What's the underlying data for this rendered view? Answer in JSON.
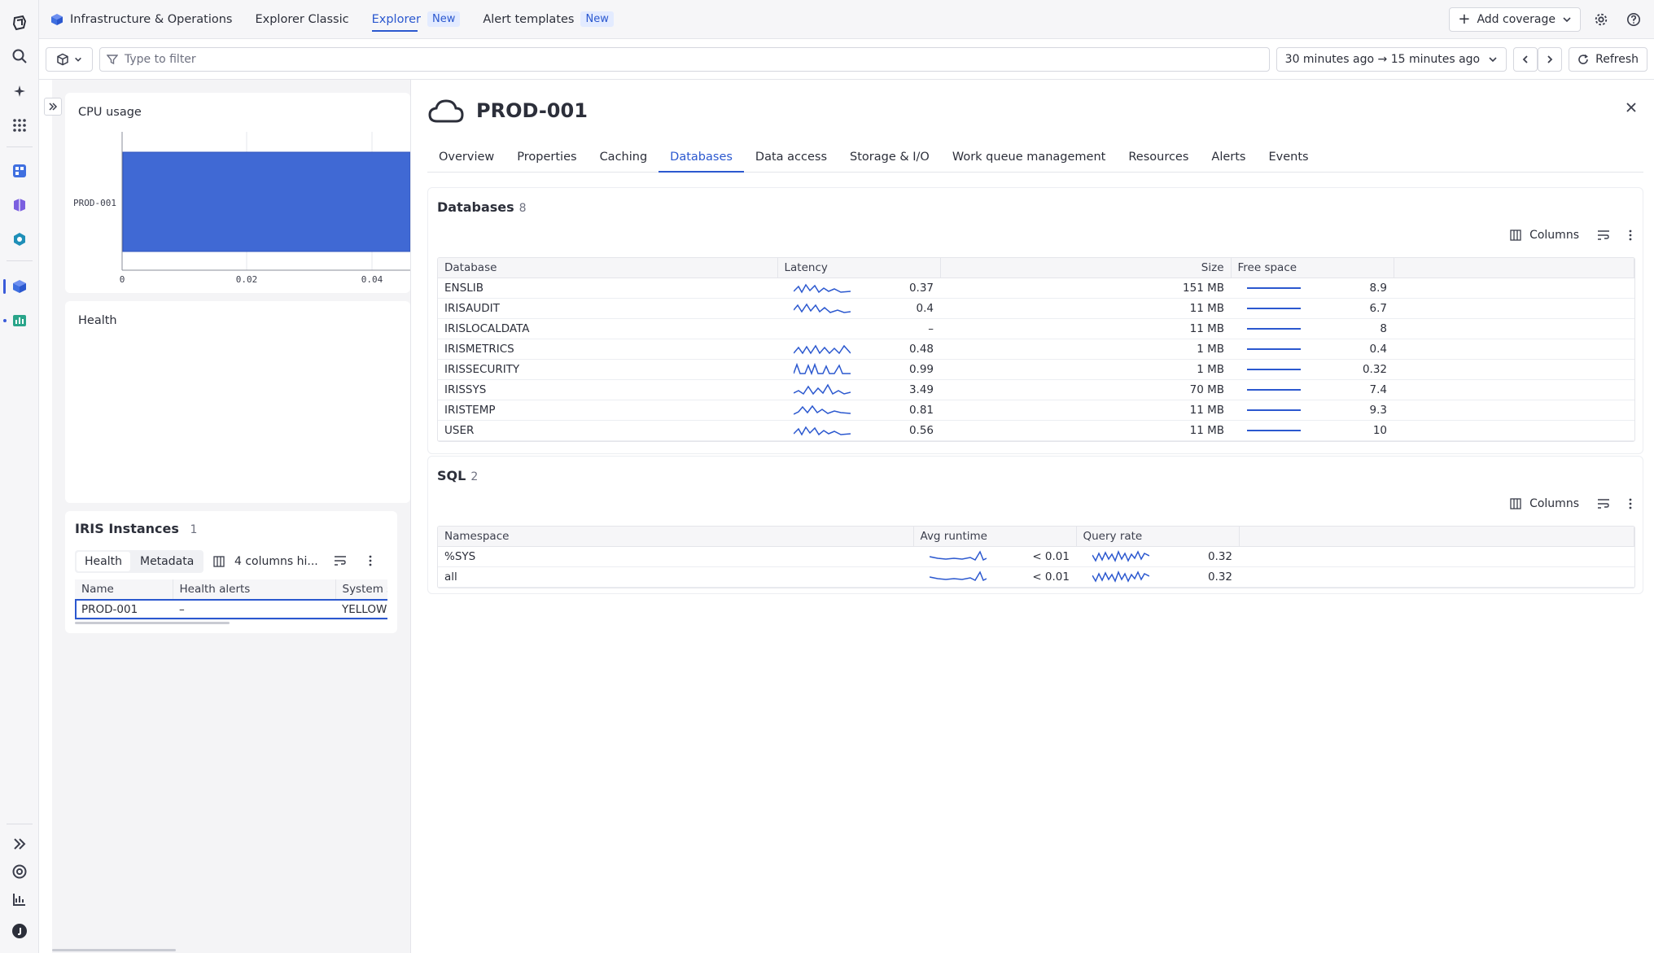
{
  "colors": {
    "accent": "#2b58cf",
    "bar_fill": "#4069d4",
    "bar_border": "#2f53bd"
  },
  "topbar": {
    "apps": [
      {
        "label": "Infrastructure & Operations",
        "badge": ""
      },
      {
        "label": "Explorer Classic",
        "badge": ""
      },
      {
        "label": "Explorer",
        "badge": "New"
      },
      {
        "label": "Alert templates",
        "badge": "New"
      }
    ],
    "add_coverage_label": "Add coverage"
  },
  "filterbar": {
    "filter_placeholder": "Type to filter",
    "timeframe": "30 minutes ago → 15 minutes ago",
    "refresh_label": "Refresh"
  },
  "left": {
    "cpu_title": "CPU usage",
    "cpu_row_label": "PROD-001",
    "cpu_ticks": [
      "0",
      "0.02",
      "0.04"
    ],
    "health_title": "Health",
    "instances_title": "IRIS Instances",
    "instances_count": "1",
    "instances_tabs": [
      "Health",
      "Metadata"
    ],
    "columns_hidden_label": "4 columns hi...",
    "instances_columns": [
      "Name",
      "Health alerts",
      "System s"
    ],
    "instances_rows": [
      {
        "name": "PROD-001",
        "alerts": "–",
        "status": "YELLOW"
      }
    ]
  },
  "detail": {
    "title": "PROD-001",
    "tabs": [
      "Overview",
      "Properties",
      "Caching",
      "Databases",
      "Data access",
      "Storage & I/O",
      "Work queue management",
      "Resources",
      "Alerts",
      "Events"
    ],
    "active_tab": "Databases",
    "databases": {
      "title": "Databases",
      "count": "8",
      "columns_label": "Columns",
      "headers": [
        "Database",
        "Latency",
        "Size",
        "Free space"
      ],
      "rows": [
        {
          "name": "ENSLIB",
          "latency": "0.37",
          "size": "151 MB",
          "free": "8.9"
        },
        {
          "name": "IRISAUDIT",
          "latency": "0.4",
          "size": "11 MB",
          "free": "6.7"
        },
        {
          "name": "IRISLOCALDATA",
          "latency": "–",
          "size": "11 MB",
          "free": "8"
        },
        {
          "name": "IRISMETRICS",
          "latency": "0.48",
          "size": "1 MB",
          "free": "0.4"
        },
        {
          "name": "IRISSECURITY",
          "latency": "0.99",
          "size": "1 MB",
          "free": "0.32"
        },
        {
          "name": "IRISSYS",
          "latency": "3.49",
          "size": "70 MB",
          "free": "7.4"
        },
        {
          "name": "IRISTEMP",
          "latency": "0.81",
          "size": "11 MB",
          "free": "9.3"
        },
        {
          "name": "USER",
          "latency": "0.56",
          "size": "11 MB",
          "free": "10"
        }
      ]
    },
    "sql": {
      "title": "SQL",
      "count": "2",
      "columns_label": "Columns",
      "headers": [
        "Namespace",
        "Avg runtime",
        "Query rate"
      ],
      "rows": [
        {
          "name": "%SYS",
          "runtime": "< 0.01",
          "rate": "0.32"
        },
        {
          "name": "all",
          "runtime": "< 0.01",
          "rate": "0.32"
        }
      ]
    }
  }
}
